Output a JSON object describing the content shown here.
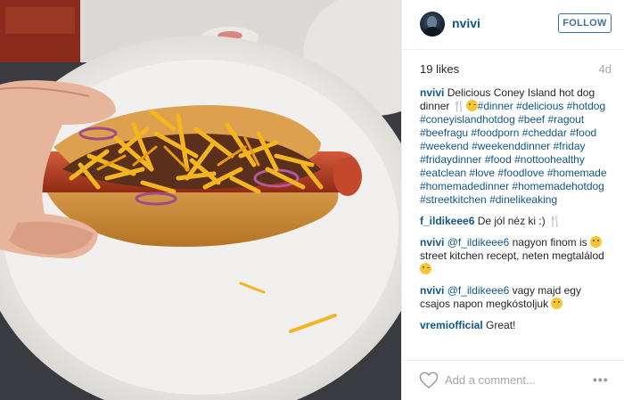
{
  "post": {
    "username": "nvivi",
    "follow_label": "FOLLOW",
    "likes": "19 likes",
    "time_ago": "4d",
    "add_comment_placeholder": "Add a comment...",
    "more_icon_glyph": "•••"
  },
  "caption": {
    "user": "nvivi",
    "text": "Delicious Coney Island hot dog dinner",
    "icons": [
      "fork-knife-icon",
      "wink-emoji-icon"
    ],
    "hashtags": [
      "#dinner",
      "#delicious",
      "#hotdog",
      "#coneyislandhotdog",
      "#beef",
      "#ragout",
      "#beefragu",
      "#foodporn",
      "#cheddar",
      "#food",
      "#weekend",
      "#weekenddinner",
      "#friday",
      "#fridaydinner",
      "#food",
      "#nottoohealthy",
      "#eatclean",
      "#love",
      "#foodlove",
      "#homemade",
      "#homemadedinner",
      "#homemadehotdog",
      "#streetkitchen",
      "#dinelikeaking"
    ]
  },
  "comments": [
    {
      "user": "f_ildikeee6",
      "text": "De jól néz ki :)",
      "icon": "fork-knife-icon"
    },
    {
      "user": "nvivi",
      "mention": "@f_ildikeee6",
      "text1": "nagyon finom is",
      "text2": "street kitchen recept, neten megtalálod",
      "icons": [
        "smile-emoji-icon",
        "wink-emoji-icon"
      ]
    },
    {
      "user": "nvivi",
      "mention": "@f_ildikeee6",
      "text": "vagy majd egy csajos napon megkóstoljuk",
      "icon": "grin-emoji-icon"
    },
    {
      "user": "vremiofficial",
      "text": "Great!"
    }
  ],
  "colors": {
    "link_blue": "#125688",
    "follow_blue": "#3f729b",
    "muted_gray": "#a5a7aa",
    "emoji_yellow": "#f6c637"
  }
}
